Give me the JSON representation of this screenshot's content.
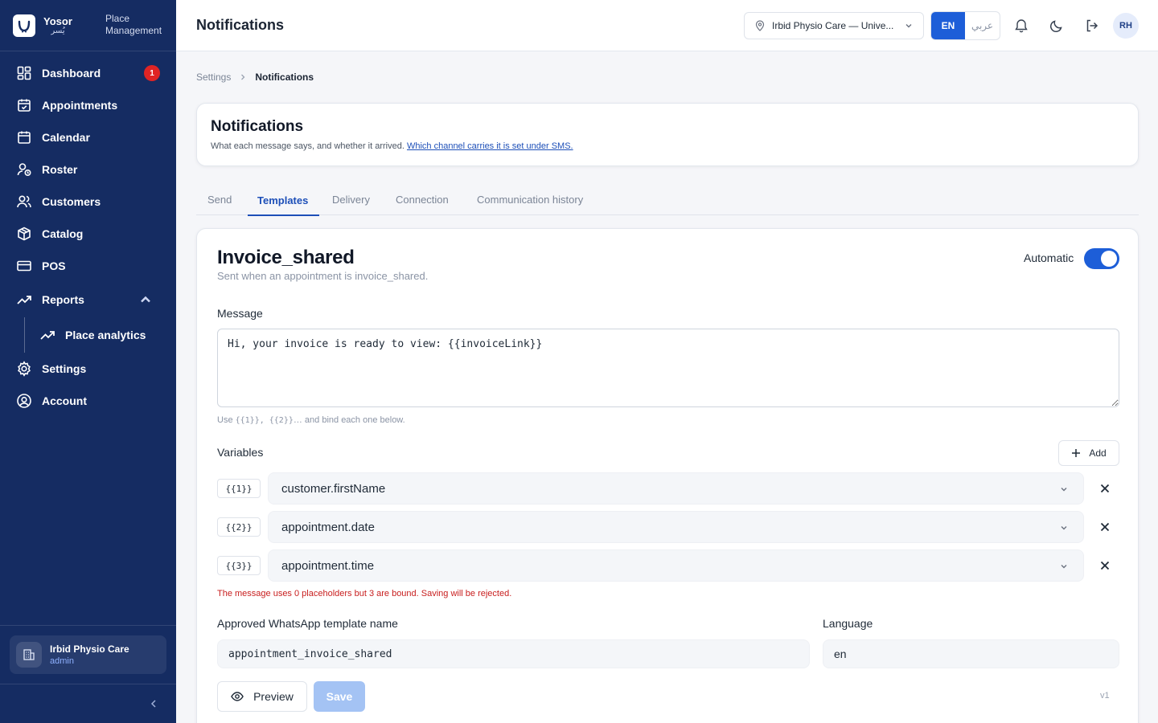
{
  "brand": {
    "name": "Yosor",
    "name_ar": "يُسر",
    "subtitle_line1": "Place",
    "subtitle_line2": "Management"
  },
  "sidebar": {
    "items": [
      {
        "label": "Dashboard",
        "icon": "dashboard-icon",
        "badge": "1"
      },
      {
        "label": "Appointments",
        "icon": "calendar-check-icon"
      },
      {
        "label": "Calendar",
        "icon": "calendar-icon"
      },
      {
        "label": "Roster",
        "icon": "user-clock-icon"
      },
      {
        "label": "Customers",
        "icon": "users-icon"
      },
      {
        "label": "Catalog",
        "icon": "box-icon"
      },
      {
        "label": "POS",
        "icon": "credit-card-icon"
      },
      {
        "label": "Reports",
        "icon": "trending-up-icon",
        "expanded": true
      },
      {
        "label": "Place analytics",
        "icon": "trending-up-icon"
      },
      {
        "label": "Settings",
        "icon": "gear-icon"
      },
      {
        "label": "Account",
        "icon": "user-circle-icon"
      }
    ],
    "place_card": {
      "name": "Irbid Physio Care",
      "role": "admin"
    }
  },
  "topbar": {
    "title": "Notifications",
    "place_select": "Irbid Physio Care — Unive...",
    "lang_en": "EN",
    "lang_ar": "عربي",
    "avatar": "RH"
  },
  "breadcrumb": {
    "parent": "Settings",
    "current": "Notifications"
  },
  "header": {
    "title": "Notifications",
    "description": "What each message says, and whether it arrived.",
    "link": "Which channel carries it is set under SMS."
  },
  "tabs": [
    {
      "label": "Send"
    },
    {
      "label": "Templates",
      "active": true
    },
    {
      "label": "Delivery"
    },
    {
      "label": "Connection"
    },
    {
      "label": "Communication history"
    }
  ],
  "template": {
    "title": "Invoice_shared",
    "subtitle": "Sent when an appointment is invoice_shared.",
    "automatic_label": "Automatic",
    "automatic_on": true,
    "message_label": "Message",
    "message": "Hi, your invoice is ready to view: {{invoiceLink}}",
    "hint_code": "{{1}}, {{2}}",
    "hint_text": "… and bind each one below.",
    "variables_label": "Variables",
    "add_label": "Add",
    "variables": [
      {
        "tag": "{{1}}",
        "value": "customer.firstName"
      },
      {
        "tag": "{{2}}",
        "value": "appointment.date"
      },
      {
        "tag": "{{3}}",
        "value": "appointment.time"
      }
    ],
    "error": "The message uses 0 placeholders but 3 are bound. Saving will be rejected.",
    "wa_label": "Approved WhatsApp template name",
    "wa_value": "appointment_invoice_shared",
    "language_label": "Language",
    "language_value": "en",
    "preview_label": "Preview",
    "save_label": "Save",
    "version": "v1"
  },
  "colors": {
    "sidebar": "#152c62",
    "accent": "#1d5ed8",
    "error": "#c81e1e",
    "badge": "#e02424"
  }
}
